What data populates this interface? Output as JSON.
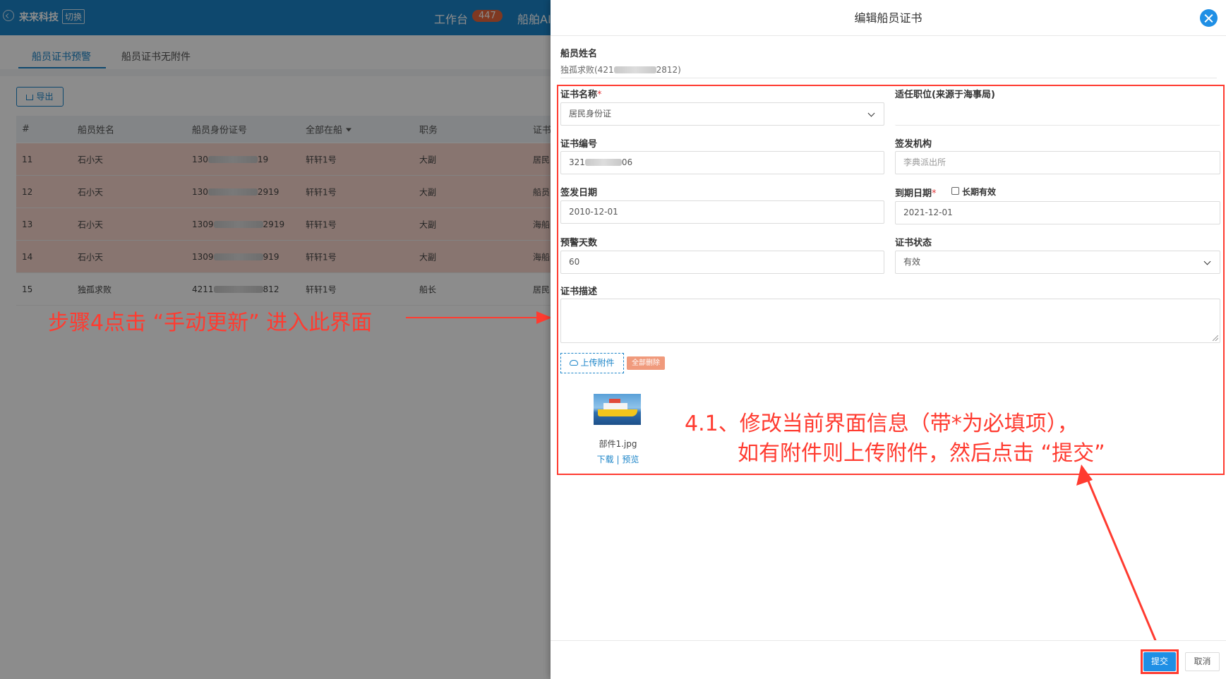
{
  "topbar": {
    "brand": "来来科技",
    "switch_label": "切换",
    "workbench": "工作台",
    "workbench_badge": "447",
    "ship_ai": "船舶AI"
  },
  "tabs": [
    "船员证书预警",
    "船员证书无附件"
  ],
  "toolbar": {
    "export_label": "导出"
  },
  "table": {
    "headers": [
      "#",
      "船员姓名",
      "船员身份证号",
      "全部在船",
      "职务",
      "证书"
    ],
    "rows": [
      {
        "no": "11",
        "name": "石小天",
        "id_prefix": "130",
        "id_suffix": "19",
        "ship": "轩轩1号",
        "duty": "大副",
        "cert": "居民",
        "warn": true
      },
      {
        "no": "12",
        "name": "石小天",
        "id_prefix": "130",
        "id_suffix": "2919",
        "ship": "轩轩1号",
        "duty": "大副",
        "cert": "船员",
        "warn": true
      },
      {
        "no": "13",
        "name": "石小天",
        "id_prefix": "1309",
        "id_suffix": "2919",
        "ship": "轩轩1号",
        "duty": "大副",
        "cert": "海船",
        "warn": true
      },
      {
        "no": "14",
        "name": "石小天",
        "id_prefix": "1309",
        "id_suffix": "919",
        "ship": "轩轩1号",
        "duty": "大副",
        "cert": "海船",
        "warn": true
      },
      {
        "no": "15",
        "name": "独孤求败",
        "id_prefix": "4211",
        "id_suffix": "812",
        "ship": "轩轩1号",
        "duty": "船长",
        "cert": "居民",
        "warn": false
      }
    ]
  },
  "annotations": {
    "step4": "步骤4点击 “手动更新” 进入此界面",
    "step41_line1": "4.1、修改当前界面信息（带*为必填项），",
    "step41_line2": "如有附件则上传附件，然后点击 “提交”"
  },
  "drawer": {
    "title": "编辑船员证书",
    "crew_name_label": "船员姓名",
    "crew_name_prefix": "独孤求败(421",
    "crew_name_suffix": "2812)",
    "form": {
      "cert_name_label": "证书名称",
      "cert_name_value": "居民身份证",
      "position_label": "适任职位(来源于海事局)",
      "position_value": "",
      "cert_no_label": "证书编号",
      "cert_no_prefix": "321",
      "cert_no_suffix": "06",
      "issuer_label": "签发机构",
      "issuer_placeholder": "李典派出所",
      "issue_date_label": "签发日期",
      "issue_date_value": "2010-12-01",
      "expire_date_label": "到期日期",
      "long_term_label": "长期有效",
      "long_term_checked": false,
      "expire_date_value": "2021-12-01",
      "warn_days_label": "预警天数",
      "warn_days_value": "60",
      "status_label": "证书状态",
      "status_value": "有效",
      "desc_label": "证书描述",
      "desc_value": "",
      "required_mark": "*"
    },
    "upload_label": "上传附件",
    "delete_all_label": "全部删除",
    "attachment": {
      "file_name": "部件1.jpg",
      "download_label": "下载",
      "preview_label": "预览",
      "link_sep": " | "
    },
    "submit_label": "提交",
    "cancel_label": "取消"
  },
  "colors": {
    "primary": "#1b84c8",
    "annotation_red": "#ff3b30",
    "warn_row": "#f7d6cc",
    "delete_btn": "#f09a7c"
  }
}
